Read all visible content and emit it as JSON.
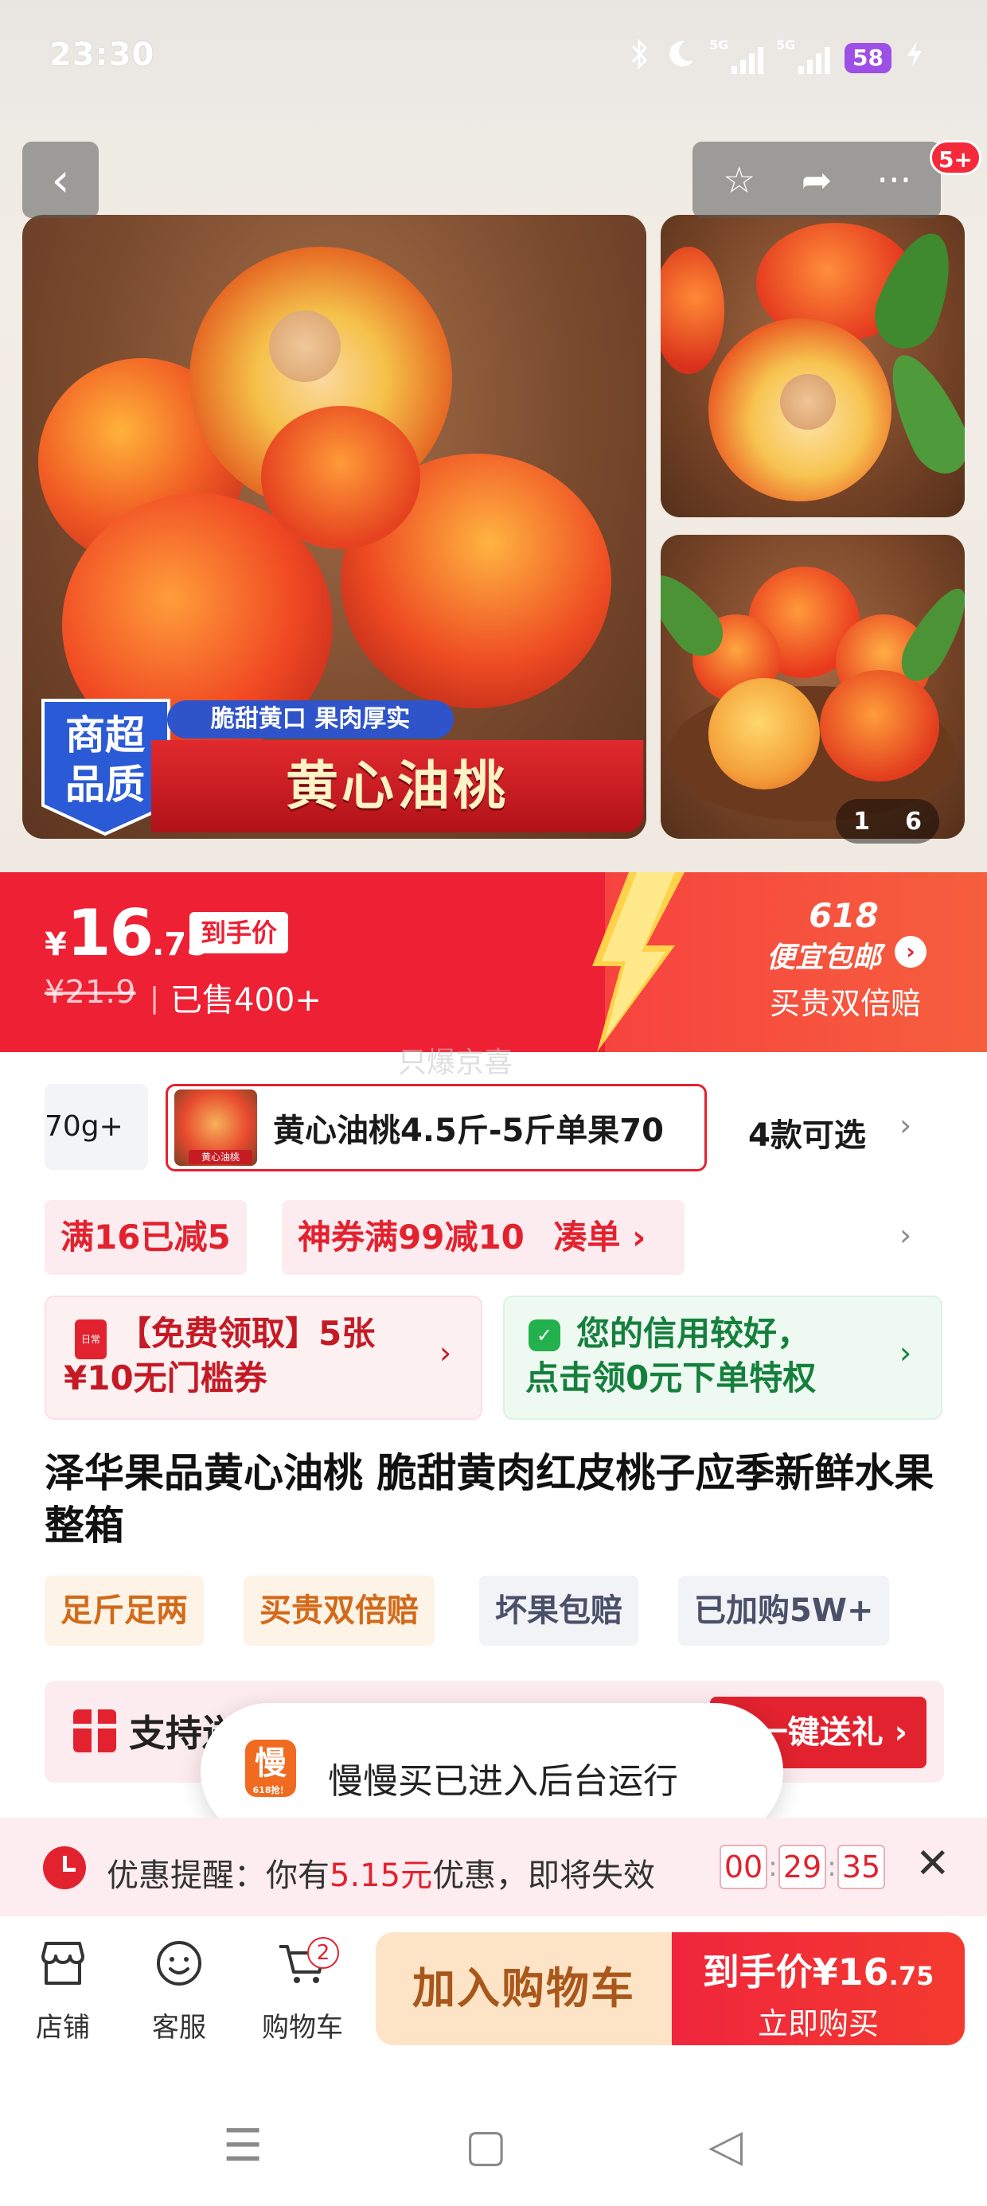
{
  "status_bar": {
    "time": "23:30",
    "network_1": "5G",
    "network_2": "5G",
    "battery": "58",
    "icons": [
      "bluetooth-icon",
      "moon-icon",
      "signal-icon",
      "signal-icon",
      "charging-icon"
    ]
  },
  "top_nav": {
    "back_icon": "‹",
    "favorite_icon": "☆",
    "share_icon": "➦",
    "more_icon": "···",
    "message_badge": "5+"
  },
  "gallery": {
    "quality_badge_line1": "商超",
    "quality_badge_line2": "品质",
    "slogan": "脆甜黄口  果肉厚实",
    "banner_title": "黄心油桃",
    "page_current": "1",
    "page_total": "6"
  },
  "price_bar": {
    "currency": "¥",
    "price_int": "16",
    "price_dec": ".75",
    "net_price_tag": "到手价",
    "original_price": "¥21.9",
    "divider": "|",
    "sold": "已售400+",
    "promo_title": "618",
    "promo_subtitle": "便宜包邮",
    "promo_arrow": "›",
    "promo_desc": "买贵双倍赔",
    "watermark": "只爆京喜"
  },
  "variants": {
    "prev_label": "70g+",
    "selected_thumb_tag": "黄心油桃",
    "selected_label": "黄心油桃4.5斤-5斤单果70",
    "count_label": "4款可选",
    "chevron": "›"
  },
  "coupons": {
    "items": [
      "满16已减5",
      "神券满99减10"
    ],
    "collect_label": "凑单 ›",
    "chevron": "›"
  },
  "benefits": {
    "free_coupon": {
      "icon_text": "日常",
      "line1": "【免费领取】5张",
      "line2": "¥10无门槛券",
      "chevron": "›"
    },
    "credit": {
      "icon_text": "✓",
      "line1": "您的信用较好，",
      "line2": "点击领0元下单特权",
      "chevron": "›"
    }
  },
  "product": {
    "title": "泽华果品黄心油桃 脆甜黄肉红皮桃子应季新鲜水果整箱",
    "tags": [
      "足斤足两",
      "买贵双倍赔",
      "坏果包赔",
      "已加购5W+"
    ]
  },
  "gift_banner": {
    "text": "支持送礼",
    "button": "一键送礼 ›"
  },
  "toast": {
    "app_icon": "慢",
    "app_icon_sub": "618抢！",
    "message": "慢慢买已进入后台运行"
  },
  "reminder": {
    "prefix": "优惠提醒：你有",
    "amount": "5.15元",
    "suffix": "优惠，即将失效",
    "hours": "00",
    "minutes": "29",
    "seconds": "35",
    "separator": ":",
    "close_icon": "✕"
  },
  "bottom_bar": {
    "store_label": "店铺",
    "service_label": "客服",
    "cart_label": "购物车",
    "cart_badge": "2",
    "add_to_cart": "加入购物车",
    "buy_price_label": "到手价¥16",
    "buy_price_dec": ".75",
    "buy_now": "立即购买"
  },
  "system_nav": {
    "menu_icon": "☰",
    "home_icon": "▢",
    "back_icon": "◁"
  },
  "colors": {
    "brand_red": "#ee2034",
    "coupon_bg": "#fdecef",
    "add_cart_bg": "#fee4c7",
    "green": "#15803d"
  }
}
